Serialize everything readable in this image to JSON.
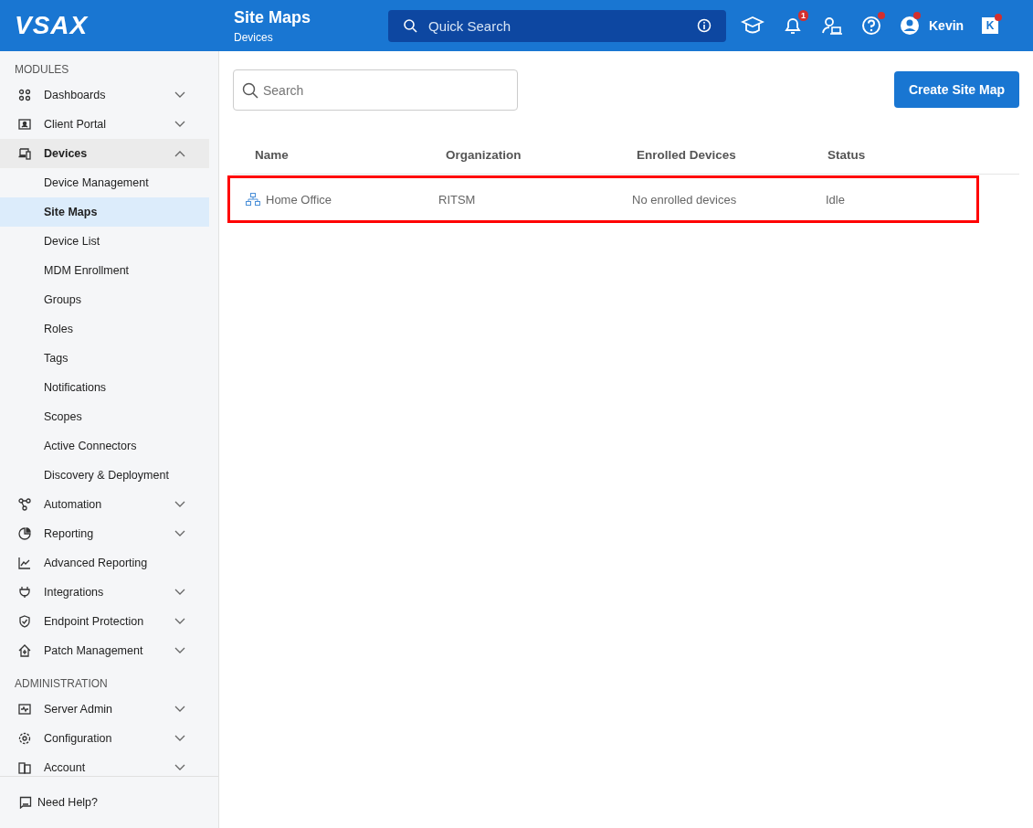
{
  "header": {
    "logo": "VSAX",
    "title": "Site Maps",
    "subtitle": "Devices",
    "search": {
      "placeholder": "Quick Search"
    },
    "tools": [
      {
        "kind": "training"
      },
      {
        "kind": "notifications",
        "badge": "1"
      },
      {
        "kind": "support"
      },
      {
        "kind": "help",
        "dot": true
      }
    ],
    "user": {
      "name": "Kevin",
      "dot": true
    },
    "app": {
      "letter": "K",
      "dot": true
    }
  },
  "sidebar": {
    "sections": [
      {
        "title": "MODULES",
        "items": [
          {
            "label": "Dashboards",
            "expanded": false,
            "selected": false
          },
          {
            "label": "Client Portal",
            "expanded": false,
            "selected": false
          },
          {
            "label": "Devices",
            "expanded": true,
            "selected": true,
            "children": [
              {
                "label": "Device Management",
                "selected": false
              },
              {
                "label": "Site Maps",
                "selected": true
              },
              {
                "label": "Device List",
                "selected": false
              },
              {
                "label": "MDM Enrollment",
                "selected": false
              },
              {
                "label": "Groups",
                "selected": false
              },
              {
                "label": "Roles",
                "selected": false
              },
              {
                "label": "Tags",
                "selected": false
              },
              {
                "label": "Notifications",
                "selected": false
              },
              {
                "label": "Scopes",
                "selected": false
              },
              {
                "label": "Active Connectors",
                "selected": false
              },
              {
                "label": "Discovery & Deployment",
                "selected": false
              }
            ]
          },
          {
            "label": "Automation",
            "expanded": false,
            "selected": false
          },
          {
            "label": "Reporting",
            "expanded": false,
            "selected": false
          },
          {
            "label": "Advanced Reporting",
            "selected": false
          },
          {
            "label": "Integrations",
            "expanded": false,
            "selected": false
          },
          {
            "label": "Endpoint Protection",
            "expanded": false,
            "selected": false
          },
          {
            "label": "Patch Management",
            "expanded": false,
            "selected": false
          }
        ]
      },
      {
        "title": "ADMINISTRATION",
        "items": [
          {
            "label": "Server Admin",
            "expanded": false,
            "selected": false
          },
          {
            "label": "Configuration",
            "expanded": false,
            "selected": false
          },
          {
            "label": "Account",
            "expanded": false,
            "selected": false
          }
        ]
      }
    ],
    "help": "Need Help?"
  },
  "main": {
    "search": {
      "placeholder": "Search"
    },
    "create_button": "Create Site Map",
    "table": {
      "columns": [
        "Name",
        "Organization",
        "Enrolled Devices",
        "Status"
      ],
      "rows": [
        {
          "cells": [
            "Home Office",
            "RITSM",
            "No enrolled devices",
            "Idle"
          ],
          "highlighted": true
        }
      ]
    }
  }
}
